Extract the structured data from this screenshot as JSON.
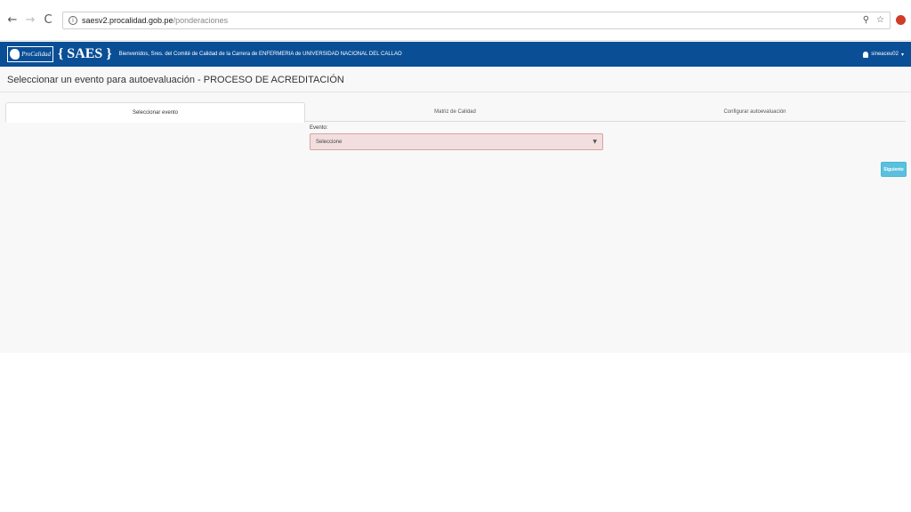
{
  "browser": {
    "url_host": "saesv2.procalidad.gob.pe",
    "url_path": "/ponderaciones",
    "icons": [
      "back-icon",
      "forward-icon",
      "reload-icon",
      "info-icon",
      "zoom-icon",
      "star-icon",
      "extension-icon"
    ],
    "glyphs": {
      "back": "←",
      "forward": "→",
      "reload": "C",
      "info": "i",
      "zoom": "⚲",
      "star": "☆"
    }
  },
  "appbar": {
    "logo_text": "ProCalidad",
    "brand": "{ SAES }",
    "welcome": "Bienvenidos, Sres. del Comité de Calidad de la Carrera de ENFERMERIA de UNIVERSIDAD NACIONAL DEL CALLAO",
    "user": "sineaceu02",
    "user_caret": "▾",
    "color": "#0a4f96"
  },
  "page": {
    "title": "Seleccionar un evento para autoevaluación - PROCESO DE ACREDITACIÓN"
  },
  "tabs": [
    {
      "label": "Seleccionar evento",
      "active": true
    },
    {
      "label": "Matriz de Calidad",
      "active": false
    },
    {
      "label": "Configurar autoevaluación",
      "active": false
    }
  ],
  "form": {
    "evento_label": "Evento:",
    "select_value": "Seleccione",
    "select_arrow": "▼"
  },
  "actions": {
    "next_label": "Siguiente",
    "next_color": "#5bc0de"
  }
}
